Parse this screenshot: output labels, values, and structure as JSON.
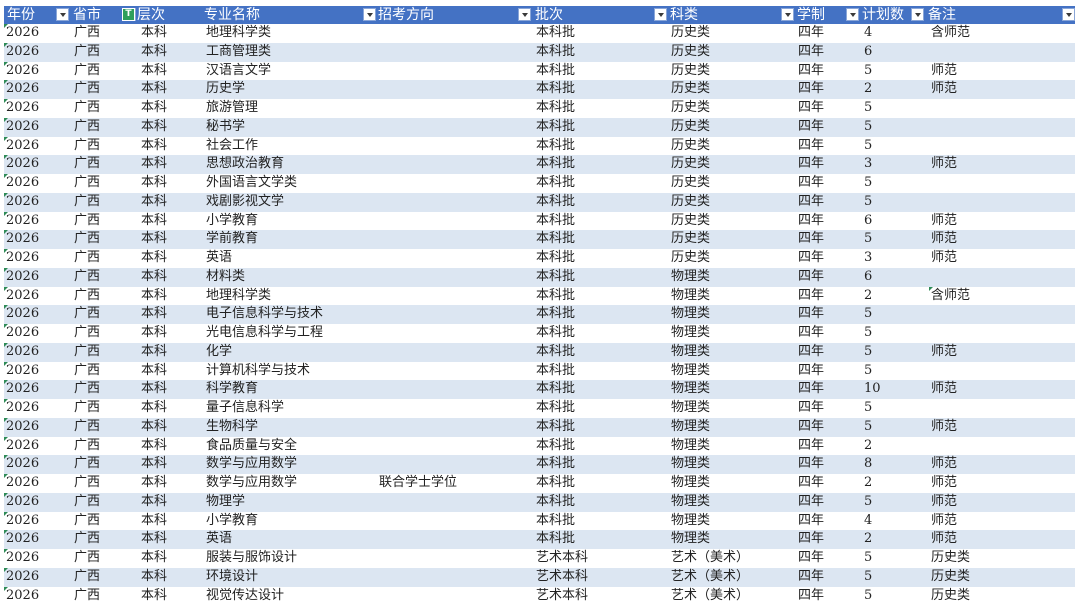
{
  "headers": [
    "年份",
    "省市",
    "层次",
    "专业名称",
    "招考方向",
    "批次",
    "科类",
    "学制",
    "计划数",
    "备注"
  ],
  "rows": [
    [
      "2026",
      "广西",
      "本科",
      "地理科学类",
      "",
      "本科批",
      "历史类",
      "四年",
      "4",
      "含师范"
    ],
    [
      "2026",
      "广西",
      "本科",
      "工商管理类",
      "",
      "本科批",
      "历史类",
      "四年",
      "6",
      ""
    ],
    [
      "2026",
      "广西",
      "本科",
      "汉语言文学",
      "",
      "本科批",
      "历史类",
      "四年",
      "5",
      "师范"
    ],
    [
      "2026",
      "广西",
      "本科",
      "历史学",
      "",
      "本科批",
      "历史类",
      "四年",
      "2",
      "师范"
    ],
    [
      "2026",
      "广西",
      "本科",
      "旅游管理",
      "",
      "本科批",
      "历史类",
      "四年",
      "5",
      ""
    ],
    [
      "2026",
      "广西",
      "本科",
      "秘书学",
      "",
      "本科批",
      "历史类",
      "四年",
      "5",
      ""
    ],
    [
      "2026",
      "广西",
      "本科",
      "社会工作",
      "",
      "本科批",
      "历史类",
      "四年",
      "5",
      ""
    ],
    [
      "2026",
      "广西",
      "本科",
      "思想政治教育",
      "",
      "本科批",
      "历史类",
      "四年",
      "3",
      "师范"
    ],
    [
      "2026",
      "广西",
      "本科",
      "外国语言文学类",
      "",
      "本科批",
      "历史类",
      "四年",
      "5",
      ""
    ],
    [
      "2026",
      "广西",
      "本科",
      "戏剧影视文学",
      "",
      "本科批",
      "历史类",
      "四年",
      "5",
      ""
    ],
    [
      "2026",
      "广西",
      "本科",
      "小学教育",
      "",
      "本科批",
      "历史类",
      "四年",
      "6",
      "师范"
    ],
    [
      "2026",
      "广西",
      "本科",
      "学前教育",
      "",
      "本科批",
      "历史类",
      "四年",
      "5",
      "师范"
    ],
    [
      "2026",
      "广西",
      "本科",
      "英语",
      "",
      "本科批",
      "历史类",
      "四年",
      "3",
      "师范"
    ],
    [
      "2026",
      "广西",
      "本科",
      "材料类",
      "",
      "本科批",
      "物理类",
      "四年",
      "6",
      ""
    ],
    [
      "2026",
      "广西",
      "本科",
      "地理科学类",
      "",
      "本科批",
      "物理类",
      "四年",
      "2",
      "含师范"
    ],
    [
      "2026",
      "广西",
      "本科",
      "电子信息科学与技术",
      "",
      "本科批",
      "物理类",
      "四年",
      "5",
      ""
    ],
    [
      "2026",
      "广西",
      "本科",
      "光电信息科学与工程",
      "",
      "本科批",
      "物理类",
      "四年",
      "5",
      ""
    ],
    [
      "2026",
      "广西",
      "本科",
      "化学",
      "",
      "本科批",
      "物理类",
      "四年",
      "5",
      "师范"
    ],
    [
      "2026",
      "广西",
      "本科",
      "计算机科学与技术",
      "",
      "本科批",
      "物理类",
      "四年",
      "5",
      ""
    ],
    [
      "2026",
      "广西",
      "本科",
      "科学教育",
      "",
      "本科批",
      "物理类",
      "四年",
      "10",
      "师范"
    ],
    [
      "2026",
      "广西",
      "本科",
      "量子信息科学",
      "",
      "本科批",
      "物理类",
      "四年",
      "5",
      ""
    ],
    [
      "2026",
      "广西",
      "本科",
      "生物科学",
      "",
      "本科批",
      "物理类",
      "四年",
      "5",
      "师范"
    ],
    [
      "2026",
      "广西",
      "本科",
      "食品质量与安全",
      "",
      "本科批",
      "物理类",
      "四年",
      "2",
      ""
    ],
    [
      "2026",
      "广西",
      "本科",
      "数学与应用数学",
      "",
      "本科批",
      "物理类",
      "四年",
      "8",
      "师范"
    ],
    [
      "2026",
      "广西",
      "本科",
      "数学与应用数学",
      "联合学士学位",
      "本科批",
      "物理类",
      "四年",
      "2",
      "师范"
    ],
    [
      "2026",
      "广西",
      "本科",
      "物理学",
      "",
      "本科批",
      "物理类",
      "四年",
      "5",
      "师范"
    ],
    [
      "2026",
      "广西",
      "本科",
      "小学教育",
      "",
      "本科批",
      "物理类",
      "四年",
      "4",
      "师范"
    ],
    [
      "2026",
      "广西",
      "本科",
      "英语",
      "",
      "本科批",
      "物理类",
      "四年",
      "2",
      "师范"
    ],
    [
      "2026",
      "广西",
      "本科",
      "服装与服饰设计",
      "",
      "艺术本科",
      "艺术（美术）",
      "四年",
      "5",
      "历史类"
    ],
    [
      "2026",
      "广西",
      "本科",
      "环境设计",
      "",
      "艺术本科",
      "艺术（美术）",
      "四年",
      "5",
      "历史类"
    ],
    [
      "2026",
      "广西",
      "本科",
      "视觉传达设计",
      "",
      "艺术本科",
      "艺术（美术）",
      "四年",
      "5",
      "历史类"
    ]
  ],
  "filter_icon_glyph": "T",
  "colors": {
    "header_bg": "#4472c4",
    "band": "#dce6f2",
    "filter_active": "#2e9e5b"
  }
}
